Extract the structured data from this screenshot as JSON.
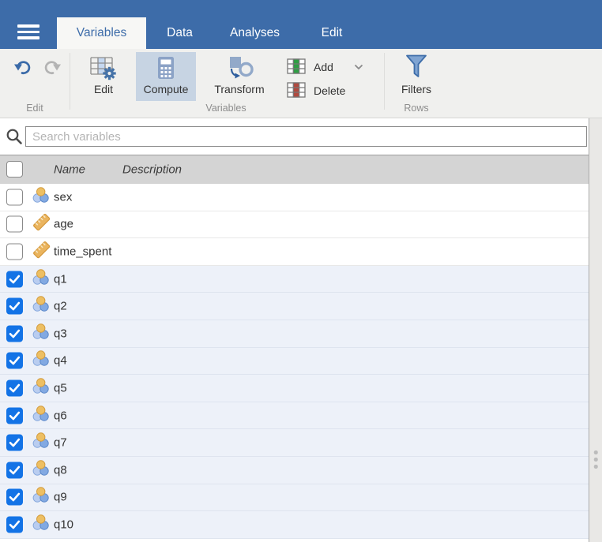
{
  "topbar": {
    "tabs": [
      {
        "label": "Variables",
        "active": true
      },
      {
        "label": "Data",
        "active": false
      },
      {
        "label": "Analyses",
        "active": false
      },
      {
        "label": "Edit",
        "active": false
      }
    ]
  },
  "toolbar": {
    "groups": {
      "edit": "Edit",
      "variables": "Variables",
      "rows": "Rows"
    },
    "buttons": {
      "edit": "Edit",
      "compute": "Compute",
      "transform": "Transform",
      "add": "Add",
      "delete": "Delete",
      "filters": "Filters"
    },
    "active_button": "Compute"
  },
  "search": {
    "placeholder": "Search variables",
    "value": ""
  },
  "variables_table": {
    "columns": [
      "Name",
      "Description"
    ],
    "rows": [
      {
        "name": "sex",
        "type": "nominal",
        "checked": false,
        "description": ""
      },
      {
        "name": "age",
        "type": "continuous",
        "checked": false,
        "description": ""
      },
      {
        "name": "time_spent",
        "type": "continuous",
        "checked": false,
        "description": ""
      },
      {
        "name": "q1",
        "type": "nominal",
        "checked": true,
        "description": ""
      },
      {
        "name": "q2",
        "type": "nominal",
        "checked": true,
        "description": ""
      },
      {
        "name": "q3",
        "type": "nominal",
        "checked": true,
        "description": ""
      },
      {
        "name": "q4",
        "type": "nominal",
        "checked": true,
        "description": ""
      },
      {
        "name": "q5",
        "type": "nominal",
        "checked": true,
        "description": ""
      },
      {
        "name": "q6",
        "type": "nominal",
        "checked": true,
        "description": ""
      },
      {
        "name": "q7",
        "type": "nominal",
        "checked": true,
        "description": ""
      },
      {
        "name": "q8",
        "type": "nominal",
        "checked": true,
        "description": ""
      },
      {
        "name": "q9",
        "type": "nominal",
        "checked": true,
        "description": ""
      },
      {
        "name": "q10",
        "type": "nominal",
        "checked": true,
        "description": ""
      }
    ]
  },
  "colors": {
    "topbar_blue": "#3d6ca9",
    "toolbar_bg": "#f0f0ee",
    "compute_highlight": "#c7d4e3",
    "header_gray": "#d4d4d4",
    "checked_checkbox_blue": "#1373e6",
    "selected_row_bg": "#edf1f9",
    "nominal_orange": "#edbf63",
    "nominal_blue": "#82a9e2",
    "continuous_ruler_orange": "#eab45e",
    "add_green": "#2f9e44",
    "delete_red": "#b0493f",
    "filter_funnel_blue": "#7fa4d2"
  }
}
